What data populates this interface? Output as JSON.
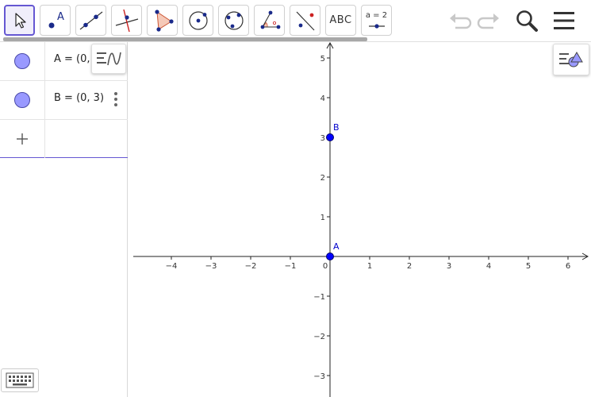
{
  "toolbar": {
    "tools": [
      {
        "name": "move",
        "icon": "cursor-arrow-icon",
        "selected": true
      },
      {
        "name": "point",
        "icon": "point-icon",
        "label": "A"
      },
      {
        "name": "line",
        "icon": "line-through-points-icon"
      },
      {
        "name": "perpendicular",
        "icon": "perpendicular-line-icon"
      },
      {
        "name": "polygon",
        "icon": "polygon-icon"
      },
      {
        "name": "circle-center",
        "icon": "circle-center-point-icon"
      },
      {
        "name": "circle-three-points",
        "icon": "circle-three-points-icon"
      },
      {
        "name": "angle",
        "icon": "angle-icon"
      },
      {
        "name": "reflect",
        "icon": "reflect-line-icon"
      },
      {
        "name": "text",
        "icon": "text-icon",
        "label": "ABC"
      },
      {
        "name": "slider",
        "icon": "slider-icon",
        "label": "a = 2"
      }
    ],
    "right": [
      "undo-icon",
      "redo-icon",
      "search-icon",
      "menu-icon"
    ]
  },
  "algebra": {
    "items": [
      {
        "label": "A = (0,",
        "color": "#9999ff"
      },
      {
        "label": "B = (0, 3)",
        "color": "#9999ff"
      }
    ],
    "input_icon": "plus-icon",
    "keyboard_icon": "keyboard-icon"
  },
  "graphics": {
    "x_ticks": [
      "−4",
      "−3",
      "−2",
      "−1",
      "0",
      "1",
      "2",
      "3",
      "4",
      "5",
      "6"
    ],
    "y_ticks_pos": [
      "1",
      "2",
      "3",
      "4",
      "5"
    ],
    "y_ticks_neg": [
      "−1",
      "−2",
      "−3"
    ],
    "point_color": "#0000ff",
    "points": [
      {
        "name": "A",
        "x": 0,
        "y": 0
      },
      {
        "name": "B",
        "x": 0,
        "y": 3
      }
    ]
  }
}
